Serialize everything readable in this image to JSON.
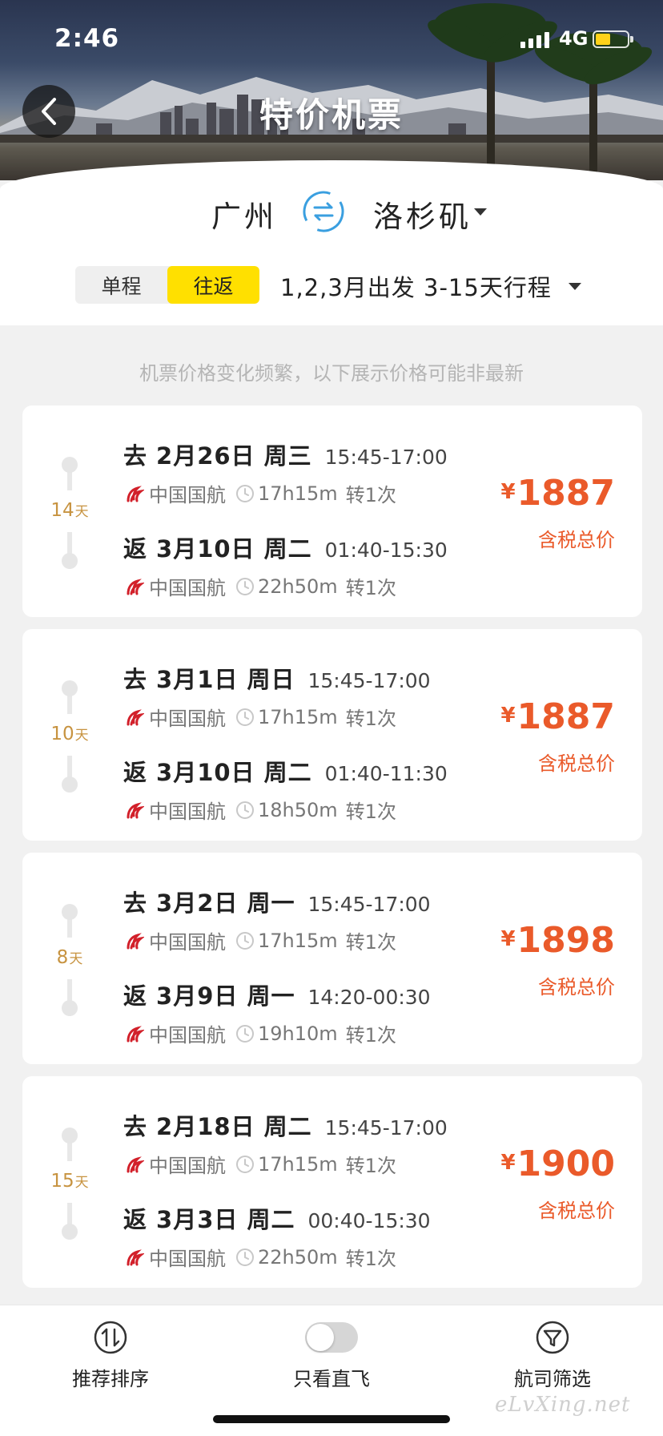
{
  "status_bar": {
    "time": "2:46",
    "network": "4G",
    "battery_color": "#ffd21a"
  },
  "header": {
    "title": "特价机票",
    "back_icon": "chevron-left-icon"
  },
  "route": {
    "from": "广州",
    "to": "洛杉矶",
    "swap_icon": "swap-arrows-icon",
    "swap_color": "#3a9fe0"
  },
  "trip_type": {
    "options": [
      "单程",
      "往返"
    ],
    "selected": "往返",
    "accent": "#ffe000"
  },
  "date_range": "1,2,3月出发 3-15天行程",
  "notice": "机票价格变化频繁，以下展示价格可能非最新",
  "price_color": "#ea5a2a",
  "cards": [
    {
      "days": "14",
      "days_unit": "天",
      "outbound": {
        "dir": "去",
        "date": "2月26日 周三",
        "time": "15:45-17:00",
        "airline": "中国国航",
        "duration": "17h15m",
        "transfer": "转1次"
      },
      "inbound": {
        "dir": "返",
        "date": "3月10日 周二",
        "time": "01:40-15:30",
        "airline": "中国国航",
        "duration": "22h50m",
        "transfer": "转1次"
      },
      "currency": "¥",
      "price": "1887",
      "price_note": "含税总价"
    },
    {
      "days": "10",
      "days_unit": "天",
      "outbound": {
        "dir": "去",
        "date": "3月1日 周日",
        "time": "15:45-17:00",
        "airline": "中国国航",
        "duration": "17h15m",
        "transfer": "转1次"
      },
      "inbound": {
        "dir": "返",
        "date": "3月10日 周二",
        "time": "01:40-11:30",
        "airline": "中国国航",
        "duration": "18h50m",
        "transfer": "转1次"
      },
      "currency": "¥",
      "price": "1887",
      "price_note": "含税总价"
    },
    {
      "days": "8",
      "days_unit": "天",
      "outbound": {
        "dir": "去",
        "date": "3月2日 周一",
        "time": "15:45-17:00",
        "airline": "中国国航",
        "duration": "17h15m",
        "transfer": "转1次"
      },
      "inbound": {
        "dir": "返",
        "date": "3月9日 周一",
        "time": "14:20-00:30",
        "airline": "中国国航",
        "duration": "19h10m",
        "transfer": "转1次"
      },
      "currency": "¥",
      "price": "1898",
      "price_note": "含税总价"
    },
    {
      "days": "15",
      "days_unit": "天",
      "outbound": {
        "dir": "去",
        "date": "2月18日 周二",
        "time": "15:45-17:00",
        "airline": "中国国航",
        "duration": "17h15m",
        "transfer": "转1次"
      },
      "inbound": {
        "dir": "返",
        "date": "3月3日 周二",
        "time": "00:40-15:30",
        "airline": "中国国航",
        "duration": "22h50m",
        "transfer": "转1次"
      },
      "currency": "¥",
      "price": "1900",
      "price_note": "含税总价"
    }
  ],
  "bottom_bar": {
    "sort": {
      "label": "推荐排序",
      "icon": "sort-icon"
    },
    "direct": {
      "label": "只看直飞",
      "icon": "toggle-switch",
      "on": false
    },
    "filter": {
      "label": "航司筛选",
      "icon": "filter-icon"
    }
  },
  "watermark": "eLvXing.net"
}
